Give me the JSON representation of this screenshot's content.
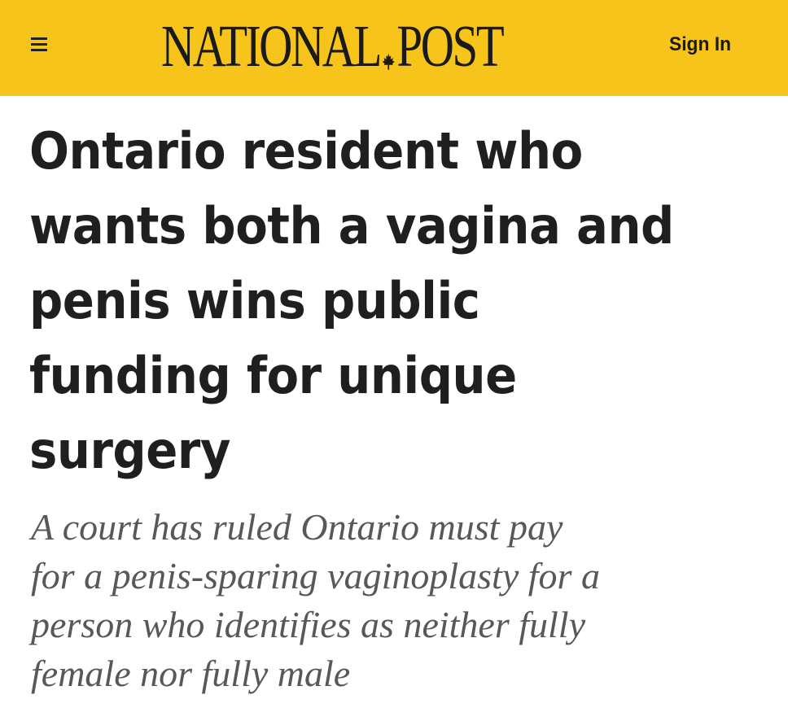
{
  "header": {
    "brand_left": "NATIONAL",
    "brand_right": "POST",
    "brand_emblem": "maple-leaf-icon",
    "sign_in_label": "Sign In",
    "background_color": "#f7c41c"
  },
  "article": {
    "headline_lines": [
      "Ontario resident who",
      "wants both a vagina and",
      "penis wins public",
      "funding for unique",
      "surgery"
    ],
    "dek_lines": [
      "A court has ruled Ontario must pay",
      "for a penis-sparing vaginoplasty for a",
      "person who identifies as neither fully",
      "female nor fully male"
    ]
  }
}
